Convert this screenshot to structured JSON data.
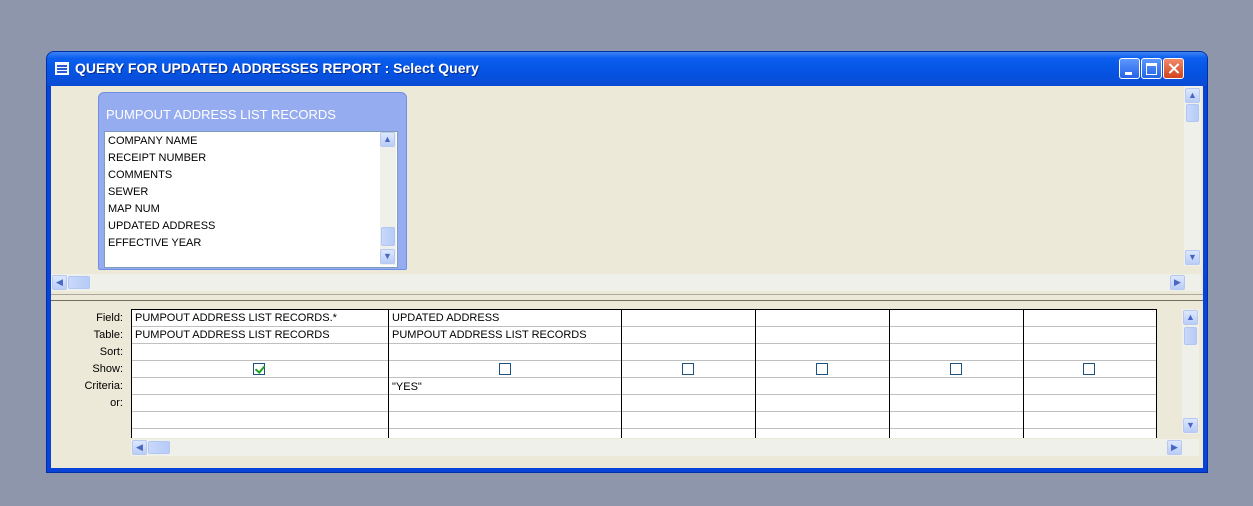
{
  "window": {
    "title": "QUERY FOR UPDATED ADDRESSES REPORT : Select Query"
  },
  "field_list": {
    "title": "PUMPOUT ADDRESS LIST RECORDS",
    "items": [
      "COMPANY NAME",
      "RECEIPT NUMBER",
      "COMMENTS",
      "SEWER",
      "MAP NUM",
      "UPDATED ADDRESS",
      "EFFECTIVE YEAR"
    ]
  },
  "grid": {
    "row_labels": [
      "Field:",
      "Table:",
      "Sort:",
      "Show:",
      "Criteria:",
      "or:"
    ],
    "columns": [
      {
        "field": "PUMPOUT ADDRESS LIST RECORDS.*",
        "table": "PUMPOUT ADDRESS LIST RECORDS",
        "sort": "",
        "show": true,
        "criteria": "",
        "or": ""
      },
      {
        "field": "UPDATED ADDRESS",
        "table": "PUMPOUT ADDRESS LIST RECORDS",
        "sort": "",
        "show": false,
        "criteria": "\"YES\"",
        "or": ""
      },
      {
        "field": "",
        "table": "",
        "sort": "",
        "show": false,
        "criteria": "",
        "or": ""
      },
      {
        "field": "",
        "table": "",
        "sort": "",
        "show": false,
        "criteria": "",
        "or": ""
      },
      {
        "field": "",
        "table": "",
        "sort": "",
        "show": false,
        "criteria": "",
        "or": ""
      },
      {
        "field": "",
        "table": "",
        "sort": "",
        "show": false,
        "criteria": "",
        "or": ""
      }
    ]
  },
  "icons": {
    "window": "query-window-icon",
    "minimize": "minimize-icon",
    "maximize": "maximize-icon",
    "close": "close-icon"
  },
  "colors": {
    "titlebar": "#0553e2",
    "field_list_header": "#96acf0",
    "check": "#21a121"
  }
}
